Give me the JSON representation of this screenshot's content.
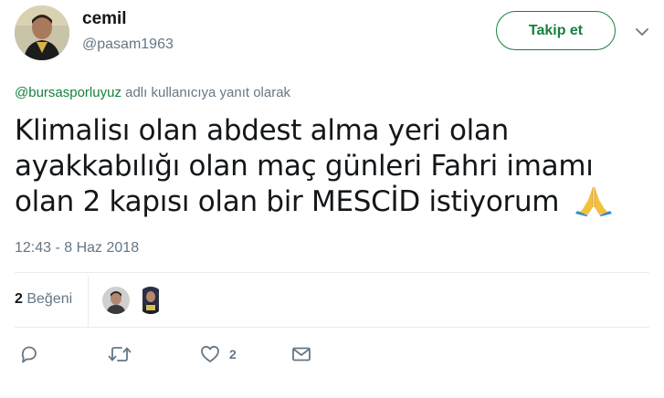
{
  "user": {
    "display_name": "cemil",
    "handle": "@pasam1963"
  },
  "follow_button_label": "Takip et",
  "reply_context": {
    "mention": "@bursasporluyuz",
    "suffix": " adlı kullanıcıya yanıt olarak"
  },
  "tweet": {
    "text": "Klimalisı olan  abdest alma yeri olan ayakkabılığı olan maç günleri Fahri imamı olan 2 kapısı olan bir MESCİD istiyorum",
    "emoji": "folded-hands",
    "timestamp": "12:43 - 8 Haz 2018"
  },
  "likes": {
    "count": "2",
    "label": "Beğeni"
  },
  "actions": {
    "reply_icon": "reply-icon",
    "retweet_icon": "retweet-icon",
    "like_icon": "heart-icon",
    "like_count": "2",
    "dm_icon": "envelope-icon"
  },
  "colors": {
    "accent": "#17803f",
    "muted": "#657786",
    "text": "#14171a",
    "divider": "#e6ecf0"
  }
}
